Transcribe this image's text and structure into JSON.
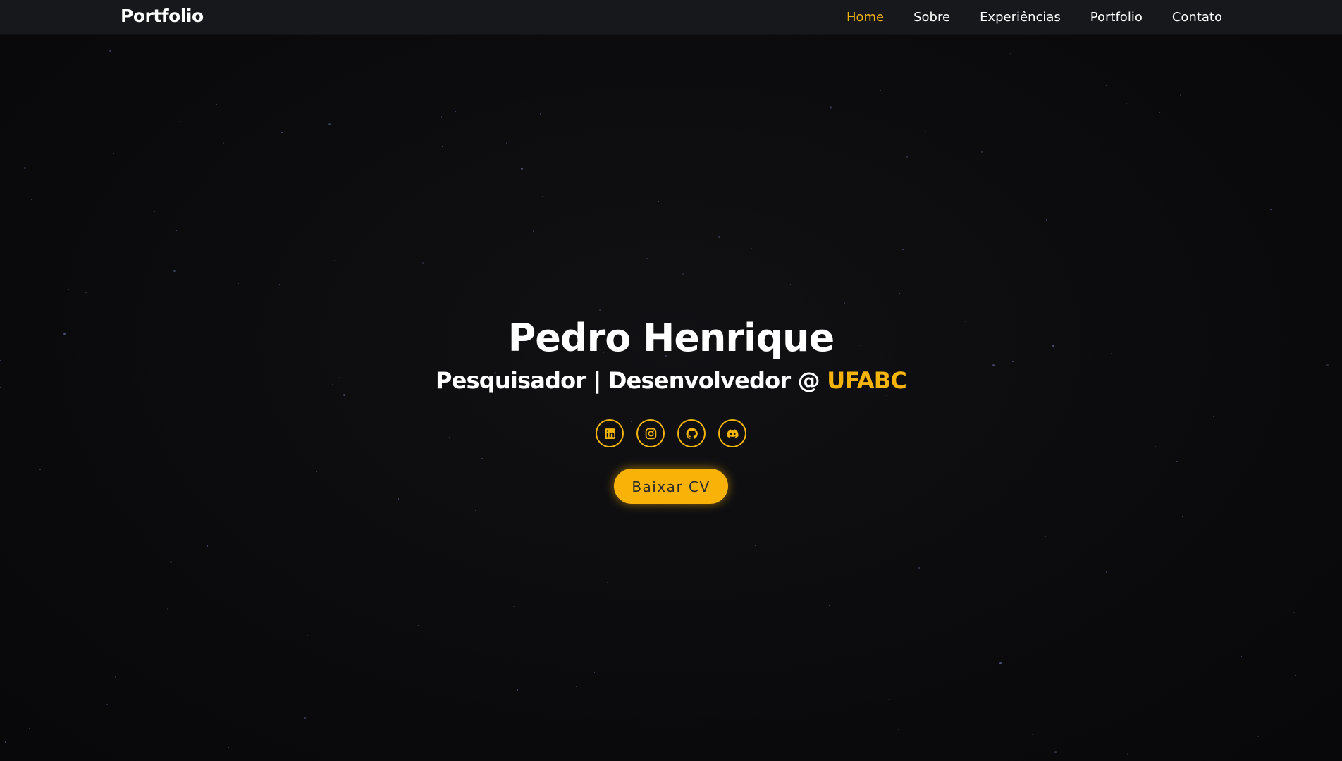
{
  "colors": {
    "background": "#0b0b0d",
    "navbar": "#17181c",
    "accent": "#f5b40c",
    "text": "#ffffff"
  },
  "navbar": {
    "brand": "Portfolio",
    "links": [
      {
        "label": "Home",
        "active": true
      },
      {
        "label": "Sobre",
        "active": false
      },
      {
        "label": "Experiências",
        "active": false
      },
      {
        "label": "Portfolio",
        "active": false
      },
      {
        "label": "Contato",
        "active": false
      }
    ]
  },
  "hero": {
    "name": "Pedro Henrique",
    "subtitle_prefix": "Pesquisador | Desenvolvedor @",
    "subtitle_highlight": "UFABC",
    "socials": [
      {
        "icon": "linkedin-icon"
      },
      {
        "icon": "instagram-icon"
      },
      {
        "icon": "github-icon"
      },
      {
        "icon": "discord-icon"
      }
    ],
    "cv_button": "Baixar CV"
  }
}
